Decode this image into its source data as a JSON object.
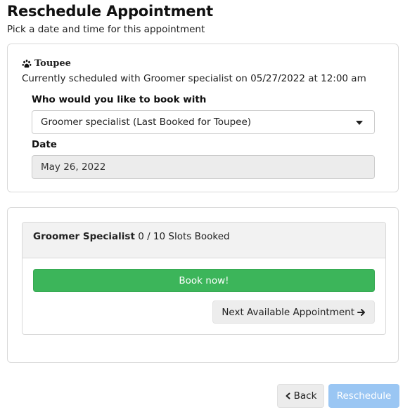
{
  "page": {
    "title": "Reschedule Appointment",
    "subtitle": "Pick a date and time for this appointment"
  },
  "appointment": {
    "pet_icon": "paw-icon",
    "pet_name": "Toupee",
    "current_schedule": "Currently scheduled with Groomer specialist on 05/27/2022 at 12:00 am",
    "book_with_label": "Who would you like to book with",
    "book_with_value": "Groomer specialist (Last Booked for Toupee)",
    "date_label": "Date",
    "date_value": "May 26, 2022"
  },
  "slots": {
    "provider": "Groomer Specialist",
    "booked_text": "0 / 10 Slots Booked",
    "book_now_label": "Book now!",
    "next_available_label": "Next Available Appointment",
    "book_now_color": "#3cb55a"
  },
  "footer": {
    "back_label": "Back",
    "reschedule_label": "Reschedule",
    "reschedule_color": "#9ac6f3"
  }
}
